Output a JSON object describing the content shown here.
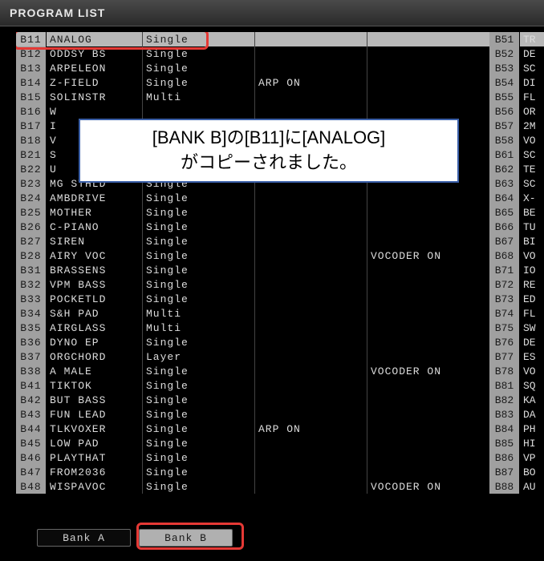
{
  "title": "PROGRAM LIST",
  "message": {
    "line1": "[BANK B]の[B11]に[ANALOG]",
    "line2": "がコピーされました。"
  },
  "bank_tabs": {
    "a": "Bank A",
    "b": "Bank B"
  },
  "selected_slot": "B11",
  "left_list": [
    {
      "slot": "B11",
      "name": "ANALOG",
      "mode": "Single",
      "flag1": "",
      "flag2": ""
    },
    {
      "slot": "B12",
      "name": "ODDSY BS",
      "mode": "Single",
      "flag1": "",
      "flag2": ""
    },
    {
      "slot": "B13",
      "name": "ARPELEON",
      "mode": "Single",
      "flag1": "",
      "flag2": ""
    },
    {
      "slot": "B14",
      "name": "Z-FIELD",
      "mode": "Single",
      "flag1": "ARP ON",
      "flag2": ""
    },
    {
      "slot": "B15",
      "name": "SOLINSTR",
      "mode": "Multi",
      "flag1": "",
      "flag2": ""
    },
    {
      "slot": "B16",
      "name": "W",
      "mode": "",
      "flag1": "",
      "flag2": ""
    },
    {
      "slot": "B17",
      "name": "I",
      "mode": "",
      "flag1": "",
      "flag2": ""
    },
    {
      "slot": "B18",
      "name": "V",
      "mode": "",
      "flag1": "",
      "flag2": ""
    },
    {
      "slot": "B21",
      "name": "S",
      "mode": "",
      "flag1": "",
      "flag2": ""
    },
    {
      "slot": "B22",
      "name": "U",
      "mode": "",
      "flag1": "",
      "flag2": ""
    },
    {
      "slot": "B23",
      "name": "MG STHLD",
      "mode": "Single",
      "flag1": "",
      "flag2": ""
    },
    {
      "slot": "B24",
      "name": "AMBDRIVE",
      "mode": "Single",
      "flag1": "",
      "flag2": ""
    },
    {
      "slot": "B25",
      "name": "MOTHER",
      "mode": "Single",
      "flag1": "",
      "flag2": ""
    },
    {
      "slot": "B26",
      "name": "C-PIANO",
      "mode": "Single",
      "flag1": "",
      "flag2": ""
    },
    {
      "slot": "B27",
      "name": "SIREN",
      "mode": "Single",
      "flag1": "",
      "flag2": ""
    },
    {
      "slot": "B28",
      "name": "AIRY VOC",
      "mode": "Single",
      "flag1": "",
      "flag2": "VOCODER ON"
    },
    {
      "slot": "B31",
      "name": "BRASSENS",
      "mode": "Single",
      "flag1": "",
      "flag2": ""
    },
    {
      "slot": "B32",
      "name": "VPM BASS",
      "mode": "Single",
      "flag1": "",
      "flag2": ""
    },
    {
      "slot": "B33",
      "name": "POCKETLD",
      "mode": "Single",
      "flag1": "",
      "flag2": ""
    },
    {
      "slot": "B34",
      "name": "S&H PAD",
      "mode": "Multi",
      "flag1": "",
      "flag2": ""
    },
    {
      "slot": "B35",
      "name": "AIRGLASS",
      "mode": "Multi",
      "flag1": "",
      "flag2": ""
    },
    {
      "slot": "B36",
      "name": "DYNO EP",
      "mode": "Single",
      "flag1": "",
      "flag2": ""
    },
    {
      "slot": "B37",
      "name": "ORGCHORD",
      "mode": "Layer",
      "flag1": "",
      "flag2": ""
    },
    {
      "slot": "B38",
      "name": "A MALE",
      "mode": "Single",
      "flag1": "",
      "flag2": "VOCODER ON"
    },
    {
      "slot": "B41",
      "name": "TIKTOK",
      "mode": "Single",
      "flag1": "",
      "flag2": ""
    },
    {
      "slot": "B42",
      "name": "BUT BASS",
      "mode": "Single",
      "flag1": "",
      "flag2": ""
    },
    {
      "slot": "B43",
      "name": "FUN LEAD",
      "mode": "Single",
      "flag1": "",
      "flag2": ""
    },
    {
      "slot": "B44",
      "name": "TLKVOXER",
      "mode": "Single",
      "flag1": "ARP ON",
      "flag2": ""
    },
    {
      "slot": "B45",
      "name": "LOW PAD",
      "mode": "Single",
      "flag1": "",
      "flag2": ""
    },
    {
      "slot": "B46",
      "name": "PLAYTHAT",
      "mode": "Single",
      "flag1": "",
      "flag2": ""
    },
    {
      "slot": "B47",
      "name": "FROM2036",
      "mode": "Single",
      "flag1": "",
      "flag2": ""
    },
    {
      "slot": "B48",
      "name": "WISPAVOC",
      "mode": "Single",
      "flag1": "",
      "flag2": "VOCODER ON"
    }
  ],
  "right_list": [
    {
      "slot": "B51",
      "name": "TR"
    },
    {
      "slot": "B52",
      "name": "DE"
    },
    {
      "slot": "B53",
      "name": "SC"
    },
    {
      "slot": "B54",
      "name": "DI"
    },
    {
      "slot": "B55",
      "name": "FL"
    },
    {
      "slot": "B56",
      "name": "OR"
    },
    {
      "slot": "B57",
      "name": "2M"
    },
    {
      "slot": "B58",
      "name": "VO"
    },
    {
      "slot": "B61",
      "name": "SC"
    },
    {
      "slot": "B62",
      "name": "TE"
    },
    {
      "slot": "B63",
      "name": "SC"
    },
    {
      "slot": "B64",
      "name": "X-"
    },
    {
      "slot": "B65",
      "name": "BE"
    },
    {
      "slot": "B66",
      "name": "TU"
    },
    {
      "slot": "B67",
      "name": "BI"
    },
    {
      "slot": "B68",
      "name": "VO"
    },
    {
      "slot": "B71",
      "name": "IO"
    },
    {
      "slot": "B72",
      "name": "RE"
    },
    {
      "slot": "B73",
      "name": "ED"
    },
    {
      "slot": "B74",
      "name": "FL"
    },
    {
      "slot": "B75",
      "name": "SW"
    },
    {
      "slot": "B76",
      "name": "DE"
    },
    {
      "slot": "B77",
      "name": "ES"
    },
    {
      "slot": "B78",
      "name": "VO"
    },
    {
      "slot": "B81",
      "name": "SQ"
    },
    {
      "slot": "B82",
      "name": "KA"
    },
    {
      "slot": "B83",
      "name": "DA"
    },
    {
      "slot": "B84",
      "name": "PH"
    },
    {
      "slot": "B85",
      "name": "HI"
    },
    {
      "slot": "B86",
      "name": "VP"
    },
    {
      "slot": "B87",
      "name": "BO"
    },
    {
      "slot": "B88",
      "name": "AU"
    }
  ]
}
